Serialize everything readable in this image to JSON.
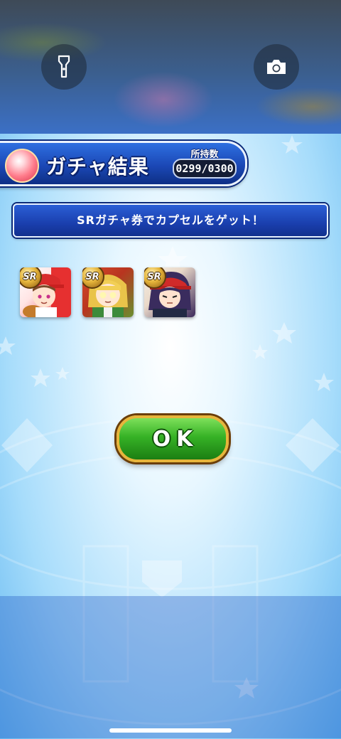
{
  "system": {
    "flashlight_icon": "flashlight-icon",
    "camera_icon": "camera-icon"
  },
  "header": {
    "title": "ガチャ結果",
    "holdings_label": "所持数",
    "holdings_count": "0299/0300"
  },
  "message": "SRガチャ券でカプセルをゲット！",
  "results": [
    {
      "rarity": "SR",
      "character": "red-cap-pitcher"
    },
    {
      "rarity": "SR",
      "character": "blonde-girl-green-uniform"
    },
    {
      "rarity": "SR",
      "character": "purple-hair-red-cap"
    }
  ],
  "ok_button": {
    "label": "OK",
    "color": "#36b226"
  },
  "colors": {
    "panel_blue": "#1b48b6",
    "gold_border": "#e7b53b",
    "background_light": "#e8f7ff"
  }
}
